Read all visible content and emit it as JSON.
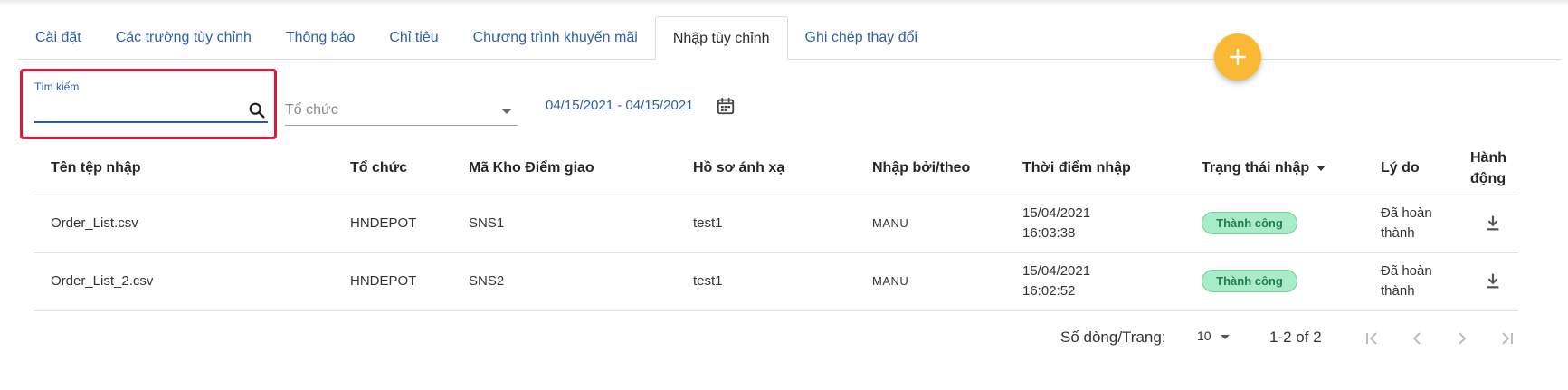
{
  "tabs": [
    {
      "label": "Cài đặt"
    },
    {
      "label": "Các trường tùy chỉnh"
    },
    {
      "label": "Thông báo"
    },
    {
      "label": "Chỉ tiêu"
    },
    {
      "label": "Chương trình khuyến mãi"
    },
    {
      "label": "Nhập tùy chỉnh"
    },
    {
      "label": "Ghi chép thay đổi"
    }
  ],
  "active_tab": "Nhập tùy chỉnh",
  "fab": {
    "icon": "plus-icon",
    "color": "#f9b934"
  },
  "filters": {
    "search": {
      "label": "Tìm kiếm",
      "value": "",
      "icon": "search-icon"
    },
    "organization": {
      "placeholder": "Tổ chức",
      "icon": "chevron-down-icon"
    },
    "date_range": {
      "value": "04/15/2021 - 04/15/2021",
      "icon": "calendar-icon"
    }
  },
  "table": {
    "headers": {
      "file": "Tên tệp nhập",
      "org": "Tổ chức",
      "code": "Mã Kho Điểm giao",
      "profile": "Hồ sơ ánh xạ",
      "by": "Nhập bởi/theo",
      "time": "Thời điểm nhập",
      "status": "Trạng thái nhập",
      "reason": "Lý do",
      "action_1": "Hành",
      "action_2": "động"
    },
    "rows": [
      {
        "file": "Order_List.csv",
        "org": "HNDEPOT",
        "code": "SNS1",
        "profile": "test1",
        "by": "MANU",
        "date": "15/04/2021",
        "time": "16:03:38",
        "status": "Thành công",
        "reason_1": "Đã hoàn",
        "reason_2": "thành",
        "action_icon": "download-icon"
      },
      {
        "file": "Order_List_2.csv",
        "org": "HNDEPOT",
        "code": "SNS2",
        "profile": "test1",
        "by": "MANU",
        "date": "15/04/2021",
        "time": "16:02:52",
        "status": "Thành công",
        "reason_1": "Đã hoàn",
        "reason_2": "thành",
        "action_icon": "download-icon"
      }
    ]
  },
  "pagination": {
    "rows_label": "Số dòng/Trang:",
    "rows_per_page": "10",
    "range": "1-2 of 2",
    "icons": [
      "first-page-icon",
      "prev-page-icon",
      "next-page-icon",
      "last-page-icon"
    ]
  },
  "colors": {
    "accent": "#2b5cab",
    "highlight": "#e0183c",
    "success_bg": "#a9ecc9",
    "success_text": "#1e7f4c"
  }
}
